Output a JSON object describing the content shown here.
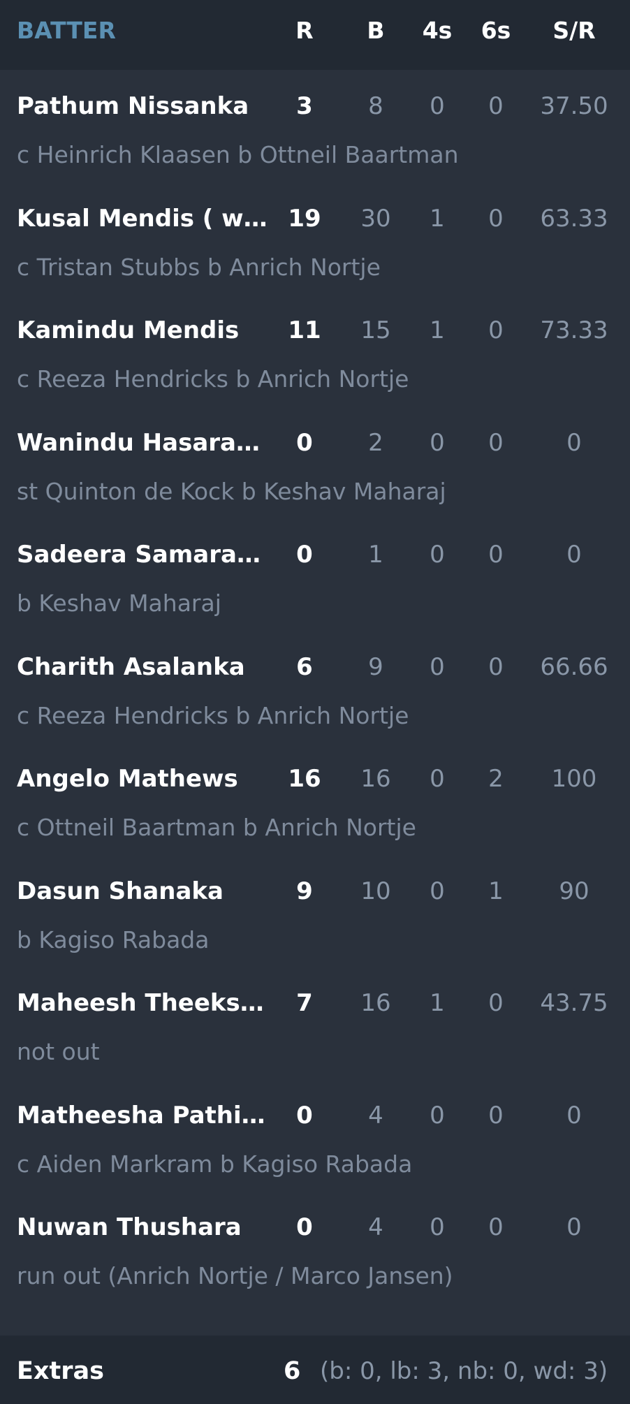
{
  "header": {
    "batter": "BATTER",
    "runs": "R",
    "balls": "B",
    "fours": "4s",
    "sixes": "6s",
    "strike_rate": "S/R"
  },
  "batters": [
    {
      "name": "Pathum Nissanka",
      "runs": "3",
      "balls": "8",
      "fours": "0",
      "sixes": "0",
      "sr": "37.50",
      "dismissal": "c Heinrich Klaasen b Ottneil Baartman"
    },
    {
      "name": "Kusal Mendis ( wk )",
      "runs": "19",
      "balls": "30",
      "fours": "1",
      "sixes": "0",
      "sr": "63.33",
      "dismissal": "c Tristan Stubbs b Anrich Nortje"
    },
    {
      "name": "Kamindu Mendis",
      "runs": "11",
      "balls": "15",
      "fours": "1",
      "sixes": "0",
      "sr": "73.33",
      "dismissal": "c Reeza Hendricks b Anrich Nortje"
    },
    {
      "name": "Wanindu Hasaran…",
      "runs": "0",
      "balls": "2",
      "fours": "0",
      "sixes": "0",
      "sr": "0",
      "dismissal": "st Quinton de Kock b Keshav Maharaj"
    },
    {
      "name": "Sadeera Samaraw…",
      "runs": "0",
      "balls": "1",
      "fours": "0",
      "sixes": "0",
      "sr": "0",
      "dismissal": "b Keshav Maharaj"
    },
    {
      "name": "Charith Asalanka",
      "runs": "6",
      "balls": "9",
      "fours": "0",
      "sixes": "0",
      "sr": "66.66",
      "dismissal": "c Reeza Hendricks b Anrich Nortje"
    },
    {
      "name": "Angelo Mathews",
      "runs": "16",
      "balls": "16",
      "fours": "0",
      "sixes": "2",
      "sr": "100",
      "dismissal": "c Ottneil Baartman b Anrich Nortje"
    },
    {
      "name": "Dasun Shanaka",
      "runs": "9",
      "balls": "10",
      "fours": "0",
      "sixes": "1",
      "sr": "90",
      "dismissal": "b Kagiso Rabada"
    },
    {
      "name": "Maheesh Theeks…",
      "runs": "7",
      "balls": "16",
      "fours": "1",
      "sixes": "0",
      "sr": "43.75",
      "dismissal": "not out"
    },
    {
      "name": "Matheesha Pathir…",
      "runs": "0",
      "balls": "4",
      "fours": "0",
      "sixes": "0",
      "sr": "0",
      "dismissal": "c Aiden Markram b Kagiso Rabada"
    },
    {
      "name": "Nuwan Thushara",
      "runs": "0",
      "balls": "4",
      "fours": "0",
      "sixes": "0",
      "sr": "0",
      "dismissal": "run out (Anrich Nortje / Marco Jansen)"
    }
  ],
  "extras": {
    "label": "Extras",
    "total": "6",
    "detail": "(b: 0, lb: 3, nb: 0, wd: 3)"
  }
}
